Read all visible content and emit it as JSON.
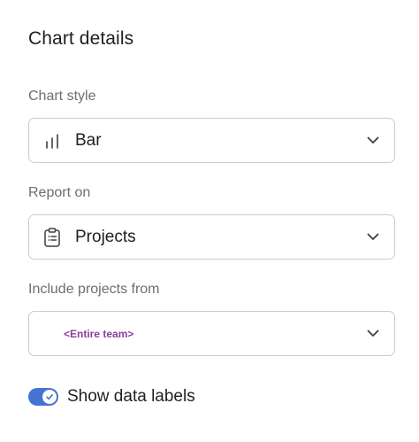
{
  "panel": {
    "title": "Chart details"
  },
  "chart_style": {
    "label": "Chart style",
    "value": "Bar",
    "icon": "bar-chart-icon"
  },
  "report_on": {
    "label": "Report on",
    "value": "Projects",
    "icon": "clipboard-list-icon"
  },
  "include_from": {
    "label": "Include projects from",
    "value": "<Entire team>"
  },
  "data_labels": {
    "label": "Show data labels",
    "enabled": true
  },
  "colors": {
    "accent": "#4573d2",
    "placeholder_purple": "#8d3da0",
    "label_gray": "#6d6e6f",
    "border": "#cfcbcb"
  }
}
